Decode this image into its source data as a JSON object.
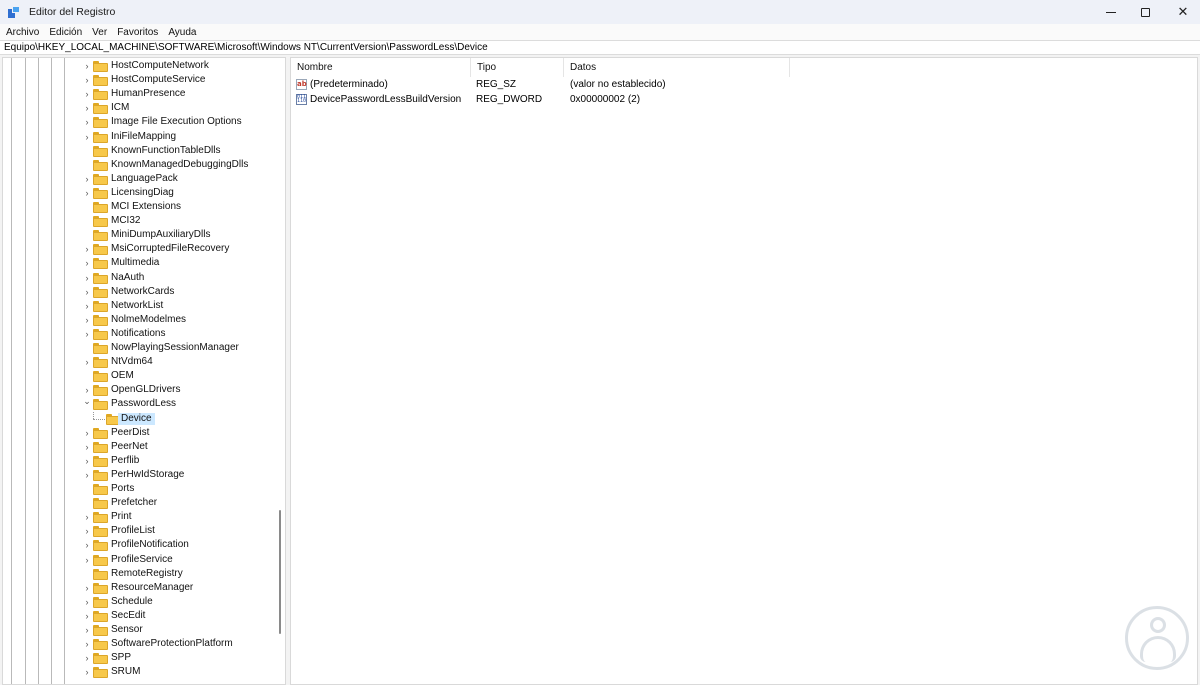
{
  "window": {
    "title": "Editor del Registro",
    "controls": [
      "minimize",
      "maximize",
      "close"
    ]
  },
  "menu": [
    "Archivo",
    "Edición",
    "Ver",
    "Favoritos",
    "Ayuda"
  ],
  "address": "Equipo\\HKEY_LOCAL_MACHINE\\SOFTWARE\\Microsoft\\Windows NT\\CurrentVersion\\PasswordLess\\Device",
  "tree": {
    "items": [
      {
        "label": "HostComputeNetwork",
        "expander": "collapsed"
      },
      {
        "label": "HostComputeService",
        "expander": "collapsed"
      },
      {
        "label": "HumanPresence",
        "expander": "collapsed"
      },
      {
        "label": "ICM",
        "expander": "collapsed"
      },
      {
        "label": "Image File Execution Options",
        "expander": "collapsed"
      },
      {
        "label": "IniFileMapping",
        "expander": "collapsed"
      },
      {
        "label": "KnownFunctionTableDlls",
        "expander": "none"
      },
      {
        "label": "KnownManagedDebuggingDlls",
        "expander": "none"
      },
      {
        "label": "LanguagePack",
        "expander": "collapsed"
      },
      {
        "label": "LicensingDiag",
        "expander": "collapsed"
      },
      {
        "label": "MCI Extensions",
        "expander": "none"
      },
      {
        "label": "MCI32",
        "expander": "none"
      },
      {
        "label": "MiniDumpAuxiliaryDlls",
        "expander": "none"
      },
      {
        "label": "MsiCorruptedFileRecovery",
        "expander": "collapsed"
      },
      {
        "label": "Multimedia",
        "expander": "collapsed"
      },
      {
        "label": "NaAuth",
        "expander": "collapsed"
      },
      {
        "label": "NetworkCards",
        "expander": "collapsed"
      },
      {
        "label": "NetworkList",
        "expander": "collapsed"
      },
      {
        "label": "NolmeModelmes",
        "expander": "collapsed"
      },
      {
        "label": "Notifications",
        "expander": "collapsed"
      },
      {
        "label": "NowPlayingSessionManager",
        "expander": "none"
      },
      {
        "label": "NtVdm64",
        "expander": "collapsed"
      },
      {
        "label": "OEM",
        "expander": "none"
      },
      {
        "label": "OpenGLDrivers",
        "expander": "collapsed"
      },
      {
        "label": "PasswordLess",
        "expander": "expanded"
      },
      {
        "label": "Device",
        "expander": "child",
        "selected": true
      },
      {
        "label": "PeerDist",
        "expander": "collapsed"
      },
      {
        "label": "PeerNet",
        "expander": "collapsed"
      },
      {
        "label": "Perflib",
        "expander": "collapsed"
      },
      {
        "label": "PerHwIdStorage",
        "expander": "collapsed"
      },
      {
        "label": "Ports",
        "expander": "none"
      },
      {
        "label": "Prefetcher",
        "expander": "none"
      },
      {
        "label": "Print",
        "expander": "collapsed"
      },
      {
        "label": "ProfileList",
        "expander": "collapsed"
      },
      {
        "label": "ProfileNotification",
        "expander": "collapsed"
      },
      {
        "label": "ProfileService",
        "expander": "collapsed"
      },
      {
        "label": "RemoteRegistry",
        "expander": "none"
      },
      {
        "label": "ResourceManager",
        "expander": "collapsed"
      },
      {
        "label": "Schedule",
        "expander": "collapsed"
      },
      {
        "label": "SecEdit",
        "expander": "collapsed"
      },
      {
        "label": "Sensor",
        "expander": "collapsed"
      },
      {
        "label": "SoftwareProtectionPlatform",
        "expander": "collapsed"
      },
      {
        "label": "SPP",
        "expander": "collapsed"
      },
      {
        "label": "SRUM",
        "expander": "collapsed"
      }
    ]
  },
  "values": {
    "columns": [
      "Nombre",
      "Tipo",
      "Datos"
    ],
    "rows": [
      {
        "icon": "string-value-icon",
        "name": "(Predeterminado)",
        "type": "REG_SZ",
        "data": "(valor no establecido)"
      },
      {
        "icon": "binary-value-icon",
        "name": "DevicePasswordLessBuildVersion",
        "type": "REG_DWORD",
        "data": "0x00000002 (2)"
      }
    ]
  },
  "colors": {
    "folder": "#f7c84a",
    "selection": "#cce8ff",
    "titlebar": "#eef1f8"
  }
}
